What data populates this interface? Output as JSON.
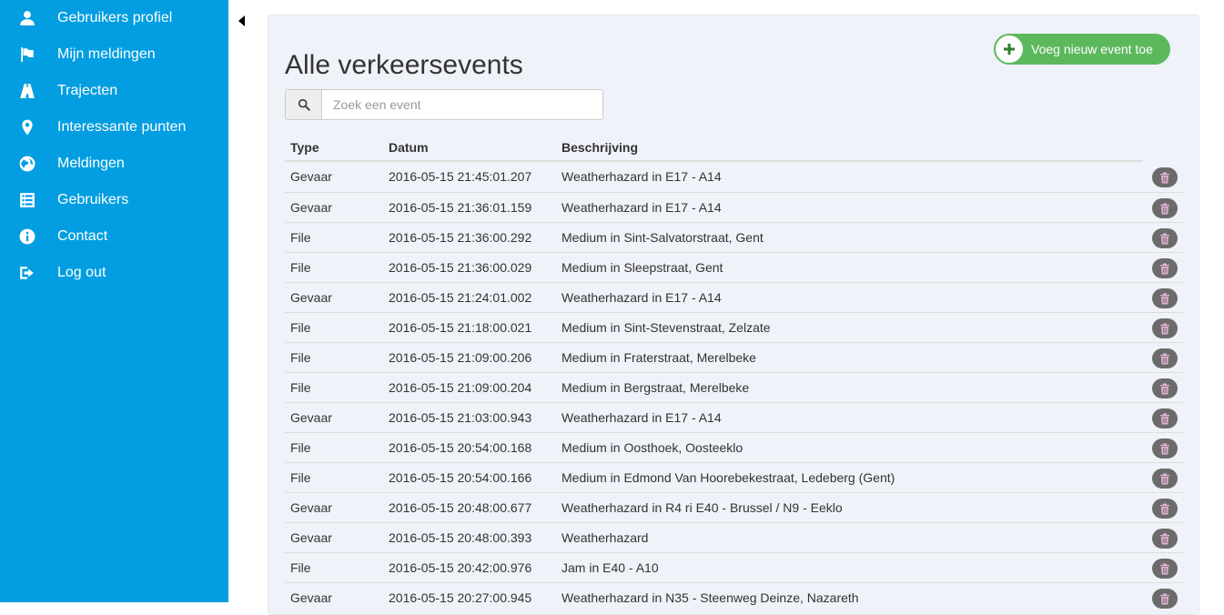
{
  "sidebar": {
    "items": [
      {
        "label": "Gebruikers profiel",
        "icon": "user-icon"
      },
      {
        "label": "Mijn meldingen",
        "icon": "flag-icon"
      },
      {
        "label": "Trajecten",
        "icon": "road-icon"
      },
      {
        "label": "Interessante punten",
        "icon": "map-marker-icon"
      },
      {
        "label": "Meldingen",
        "icon": "globe-icon"
      },
      {
        "label": "Gebruikers",
        "icon": "list-icon"
      },
      {
        "label": "Contact",
        "icon": "info-icon"
      },
      {
        "label": "Log out",
        "icon": "log-out-icon"
      }
    ]
  },
  "main": {
    "title": "Alle verkeersevents",
    "add_button": "Voeg nieuw event toe",
    "search_placeholder": "Zoek een event",
    "search_value": "",
    "columns": [
      "Type",
      "Datum",
      "Beschrijving"
    ],
    "rows": [
      {
        "type": "Gevaar",
        "date": "2016-05-15 21:45:01.207",
        "desc": "Weatherhazard in E17 - A14"
      },
      {
        "type": "Gevaar",
        "date": "2016-05-15 21:36:01.159",
        "desc": "Weatherhazard in E17 - A14"
      },
      {
        "type": "File",
        "date": "2016-05-15 21:36:00.292",
        "desc": "Medium in Sint-Salvatorstraat, Gent"
      },
      {
        "type": "File",
        "date": "2016-05-15 21:36:00.029",
        "desc": "Medium in Sleepstraat, Gent"
      },
      {
        "type": "Gevaar",
        "date": "2016-05-15 21:24:01.002",
        "desc": "Weatherhazard in E17 - A14"
      },
      {
        "type": "File",
        "date": "2016-05-15 21:18:00.021",
        "desc": "Medium in Sint-Stevenstraat, Zelzate"
      },
      {
        "type": "File",
        "date": "2016-05-15 21:09:00.206",
        "desc": "Medium in Fraterstraat, Merelbeke"
      },
      {
        "type": "File",
        "date": "2016-05-15 21:09:00.204",
        "desc": "Medium in Bergstraat, Merelbeke"
      },
      {
        "type": "Gevaar",
        "date": "2016-05-15 21:03:00.943",
        "desc": "Weatherhazard in E17 - A14"
      },
      {
        "type": "File",
        "date": "2016-05-15 20:54:00.168",
        "desc": "Medium in Oosthoek, Oosteeklo"
      },
      {
        "type": "File",
        "date": "2016-05-15 20:54:00.166",
        "desc": "Medium in Edmond Van Hoorebekestraat, Ledeberg (Gent)"
      },
      {
        "type": "Gevaar",
        "date": "2016-05-15 20:48:00.677",
        "desc": "Weatherhazard in R4 ri E40 - Brussel / N9 - Eeklo"
      },
      {
        "type": "Gevaar",
        "date": "2016-05-15 20:48:00.393",
        "desc": "Weatherhazard"
      },
      {
        "type": "File",
        "date": "2016-05-15 20:42:00.976",
        "desc": "Jam in E40 - A10"
      },
      {
        "type": "Gevaar",
        "date": "2016-05-15 20:27:00.945",
        "desc": "Weatherhazard in N35 - Steenweg Deinze, Nazareth"
      }
    ]
  },
  "colors": {
    "sidebar_bg": "#029ee1",
    "panel_bg": "#eff2f8",
    "add_button": "#5cb85c",
    "delete_button": "#6b6b6b",
    "trash_icon": "#e8b4d8"
  }
}
